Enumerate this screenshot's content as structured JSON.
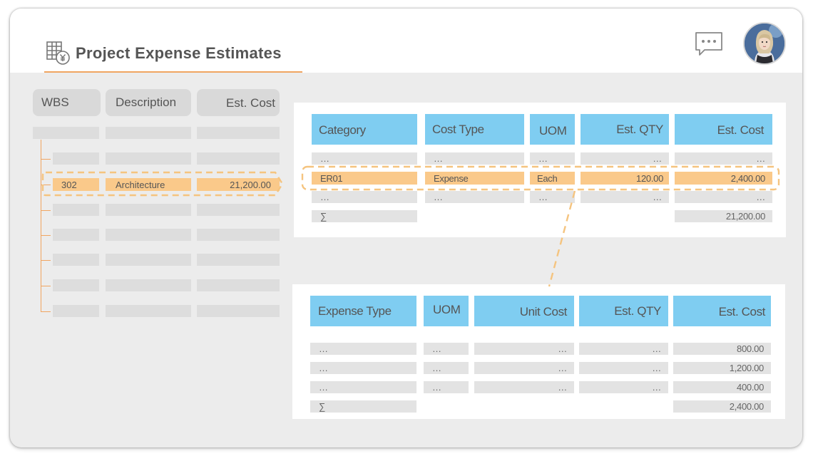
{
  "header": {
    "title": "Project Expense Estimates",
    "title_icon": "spreadsheet-yen-icon",
    "chat_icon": "chat-bubble-icon",
    "avatar": "user-avatar"
  },
  "wbs_table": {
    "columns": [
      "WBS",
      "Description",
      "Est. Cost"
    ],
    "selected_row": {
      "wbs": "302",
      "description": "Architecture",
      "est_cost": "21,200.00"
    }
  },
  "cost_table": {
    "columns": [
      "Category",
      "Cost Type",
      "UOM",
      "Est. QTY",
      "Est. Cost"
    ],
    "rows": [
      [
        "…",
        "…",
        "…",
        "…",
        "…"
      ],
      [
        "ER01",
        "Expense",
        "Each",
        "120.00",
        "2,400.00"
      ],
      [
        "…",
        "…",
        "…",
        "…",
        "…"
      ]
    ],
    "sum_symbol": "∑",
    "sum_value": "21,200.00"
  },
  "expense_table": {
    "columns": [
      "Expense Type",
      "UOM",
      "Unit Cost",
      "Est. QTY",
      "Est. Cost"
    ],
    "rows": [
      [
        "…",
        "…",
        "…",
        "…",
        "800.00"
      ],
      [
        "…",
        "…",
        "…",
        "…",
        "1,200.00"
      ],
      [
        "…",
        "…",
        "…",
        "…",
        "400.00"
      ]
    ],
    "sum_symbol": "∑",
    "sum_value": "2,400.00"
  },
  "colors": {
    "accent": "#f0a561",
    "header_blue": "#7fcdf1",
    "highlight": "#fac98a",
    "frame_bg": "#ececec"
  }
}
